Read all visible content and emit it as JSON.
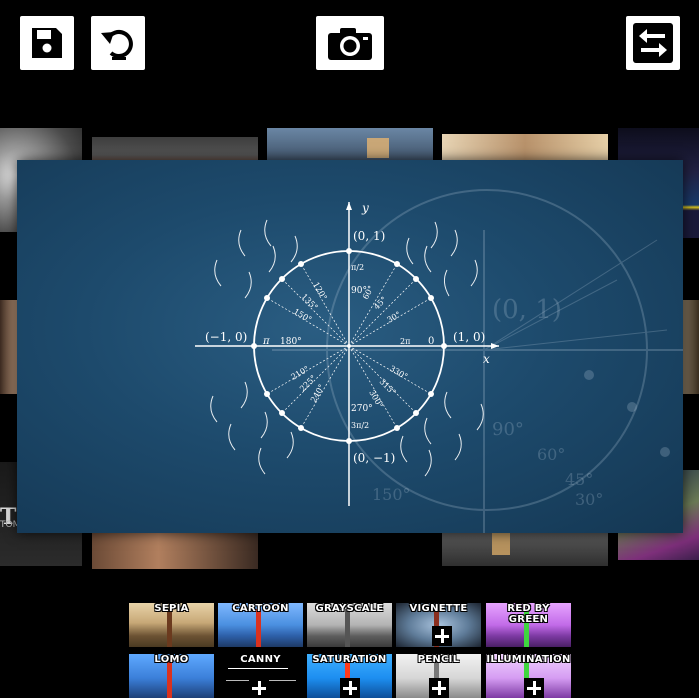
{
  "toolbar": {
    "save_icon": "save-icon",
    "reset_icon": "rotate-ccw-icon",
    "camera_icon": "camera-icon",
    "swap_icon": "swap-arrows-icon"
  },
  "background_tiles": [
    {
      "name": "dandelion-photo"
    },
    {
      "name": "dragonfly-photo"
    },
    {
      "name": "danbo-beach-photo"
    },
    {
      "name": "kitten-photo"
    },
    {
      "name": "colorful-photo"
    },
    {
      "name": "portrait-photo"
    },
    {
      "name": "poster-photo"
    },
    {
      "name": "woman-photo"
    },
    {
      "name": "danbo-stairs-photo"
    },
    {
      "name": "cat-photo"
    }
  ],
  "poster": {
    "partial_text": "TOO",
    "partial_subtext": "TOMO"
  },
  "unit_circle": {
    "y_label": "y",
    "x_label": "x",
    "top_point": "(0, 1)",
    "left_point": "(−1, 0)",
    "right_point": "(1, 0)",
    "bottom_point": "(0, −1)",
    "deg_90": "90°",
    "deg_180": "180°",
    "deg_270": "270°",
    "deg_30": "30°",
    "deg_45": "45°",
    "deg_60": "60°",
    "deg_120": "120°",
    "deg_135": "135°",
    "deg_150": "150°",
    "deg_210": "210°",
    "deg_225": "225°",
    "deg_240": "240°",
    "deg_300": "300°",
    "deg_315": "315°",
    "deg_330": "330°",
    "rad_0": "0",
    "rad_pi": "π",
    "rad_2pi": "2π",
    "rad_pi2": "π/2",
    "rad_3pi2": "3π/2",
    "bg_top_point": "(0, 1)",
    "bg_deg_90": "90°",
    "bg_deg_60": "60°",
    "bg_deg_45": "45°",
    "bg_deg_30": "30°",
    "bg_deg_150": "150°"
  },
  "filters": [
    {
      "label": "SEPIA",
      "locked": false
    },
    {
      "label": "CARTOON",
      "locked": false
    },
    {
      "label": "GRAYSCALE",
      "locked": false
    },
    {
      "label": "VIGNETTE",
      "locked": true
    },
    {
      "label": "RED BY GREEN",
      "locked": false
    },
    {
      "label": "LOMO",
      "locked": false
    },
    {
      "label": "CANNY",
      "locked": true
    },
    {
      "label": "SATURATION",
      "locked": true
    },
    {
      "label": "PENCIL",
      "locked": true
    },
    {
      "label": "ILLUMINATION",
      "locked": true
    }
  ]
}
